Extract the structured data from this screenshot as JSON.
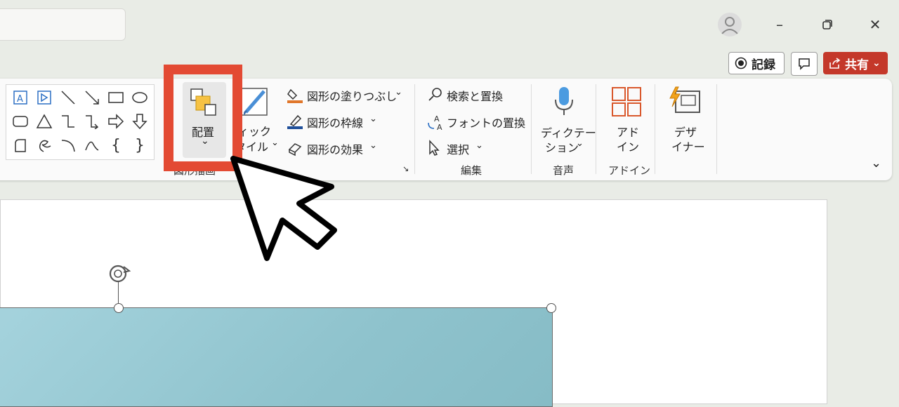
{
  "window_controls": {
    "minimize": "–",
    "restore": "❐",
    "close": "✕"
  },
  "top_right": {
    "record_label": "記録",
    "share_label": "共有",
    "share_color": "#c4382a"
  },
  "ribbon": {
    "arrange": {
      "label": "配置",
      "chevron": "⌄"
    },
    "quick_styles": {
      "label_top": "ィック",
      "label_bottom": "タイル",
      "chevron": "⌄"
    },
    "shape_fill": "図形の塗りつぶし",
    "shape_outline": "図形の枠線",
    "shape_effects": "図形の効果",
    "drawing_group_label": "図形描画",
    "find_replace": "検索と置換",
    "font_replace": "フォントの置換",
    "select": "選択",
    "editing_group_label": "編集",
    "dictation_line1": "ディクテー",
    "dictation_line2": "ション",
    "voice_group_label": "音声",
    "addins_line1": "アド",
    "addins_line2": "イン",
    "addins_group_label": "アドイン",
    "designer_line1": "デザ",
    "designer_line2": "イナー",
    "collapse": "⌄",
    "accent_color": "#e34a33"
  },
  "icons": [
    "text-box-icon",
    "vertical-text-box-icon",
    "line-icon",
    "arrow-line-icon",
    "rectangle-icon",
    "oval-icon",
    "rounded-rectangle-icon",
    "triangle-icon",
    "elbow-connector-icon",
    "elbow-arrow-connector-icon",
    "right-arrow-icon",
    "down-arrow-icon",
    "freeform-icon",
    "scribble-icon",
    "arc-icon",
    "curve-icon",
    "left-brace-icon",
    "right-brace-icon",
    "cursor-pointer-icon"
  ]
}
